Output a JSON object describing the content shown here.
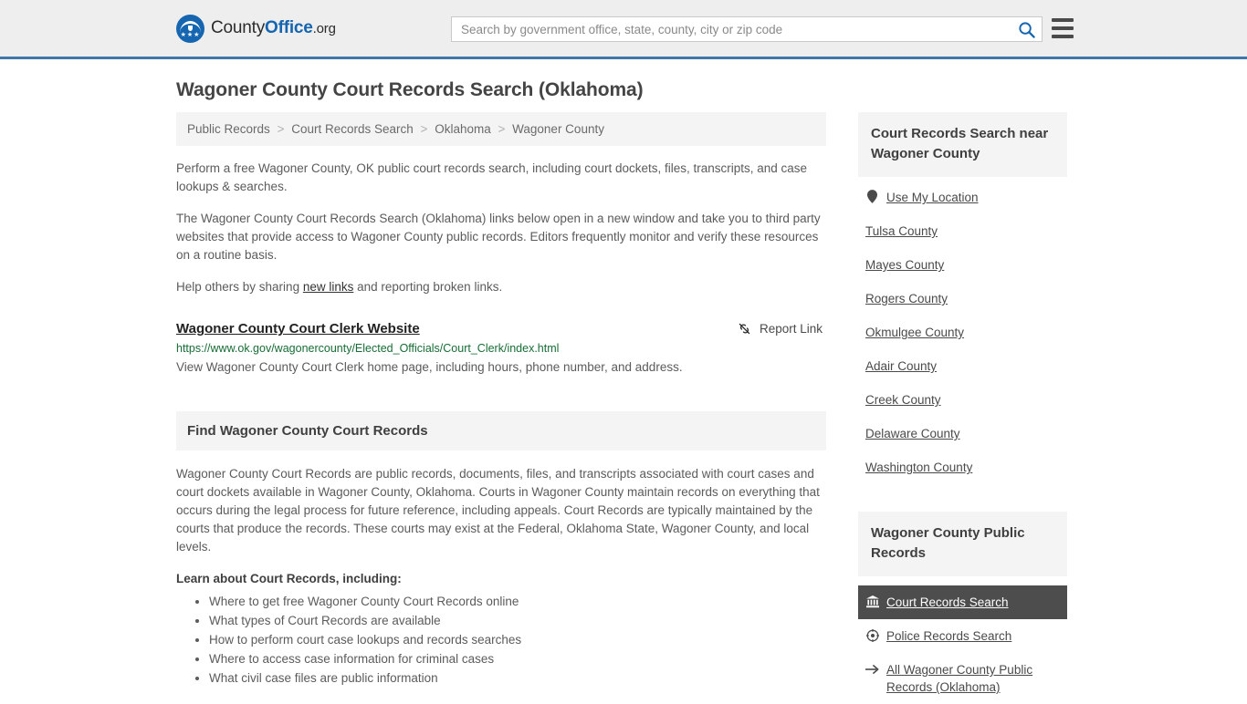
{
  "header": {
    "logo": {
      "icon": "eagle-seal-icon",
      "text_part1": "County",
      "text_part2": "Office",
      "text_part3": ".org"
    },
    "search": {
      "placeholder": "Search by government office, state, county, city or zip code",
      "value": "",
      "search_icon": "search-icon",
      "accent_color": "#1565b0"
    },
    "menu_icon": "hamburger-menu-icon",
    "background_color": "#eeeeee",
    "border_color": "#3f77aa"
  },
  "page_title": "Wagoner County Court Records Search (Oklahoma)",
  "breadcrumb": {
    "items": [
      "Public Records",
      "Court Records Search",
      "Oklahoma",
      "Wagoner County"
    ],
    "separator": ">"
  },
  "main": {
    "paragraphs": [
      "Perform a free Wagoner County, OK public court records search, including court dockets, files, transcripts, and case lookups & searches.",
      "The Wagoner County Court Records Search (Oklahoma) links below open in a new window and take you to third party websites that provide access to Wagoner County public records. Editors frequently monitor and verify these resources on a routine basis."
    ],
    "share_line": {
      "before": "Help others by sharing ",
      "link": "new links",
      "after": " and reporting broken links."
    },
    "result": {
      "title": "Wagoner County Court Clerk Website",
      "report_label": "Report Link",
      "report_icon": "broken-link-icon",
      "url": "https://www.ok.gov/wagonercounty/Elected_Officials/Court_Clerk/index.html",
      "url_color": "#176d35",
      "description": "View Wagoner County Court Clerk home page, including hours, phone number, and address."
    },
    "section": {
      "heading": "Find Wagoner County Court Records",
      "body": "Wagoner County Court Records are public records, documents, files, and transcripts associated with court cases and court dockets available in Wagoner County, Oklahoma. Courts in Wagoner County maintain records on everything that occurs during the legal process for future reference, including appeals. Court Records are typically maintained by the courts that produce the records. These courts may exist at the Federal, Oklahoma State, Wagoner County, and local levels.",
      "lead_in": "Learn about Court Records, including:",
      "bullets": [
        "Where to get free Wagoner County Court Records online",
        "What types of Court Records are available",
        "How to perform court case lookups and records searches",
        "Where to access case information for criminal cases",
        "What civil case files are public information"
      ]
    }
  },
  "sidebar": {
    "nearby": {
      "heading": "Court Records Search near Wagoner County",
      "use_my_location": {
        "label": "Use My Location",
        "icon": "location-pin-icon"
      },
      "counties": [
        "Tulsa County",
        "Mayes County",
        "Rogers County",
        "Okmulgee County",
        "Adair County",
        "Creek County",
        "Delaware County",
        "Washington County"
      ]
    },
    "public_records": {
      "heading": "Wagoner County Public Records",
      "items": [
        {
          "label": "Court Records Search",
          "icon": "courthouse-bank-icon",
          "active": true
        },
        {
          "label": "Police Records Search",
          "icon": "police-badge-icon",
          "active": false
        },
        {
          "label": "All Wagoner County Public Records (Oklahoma)",
          "icon": "arrow-right-icon",
          "active": false
        }
      ],
      "active_background": "#4d4d4d"
    }
  }
}
